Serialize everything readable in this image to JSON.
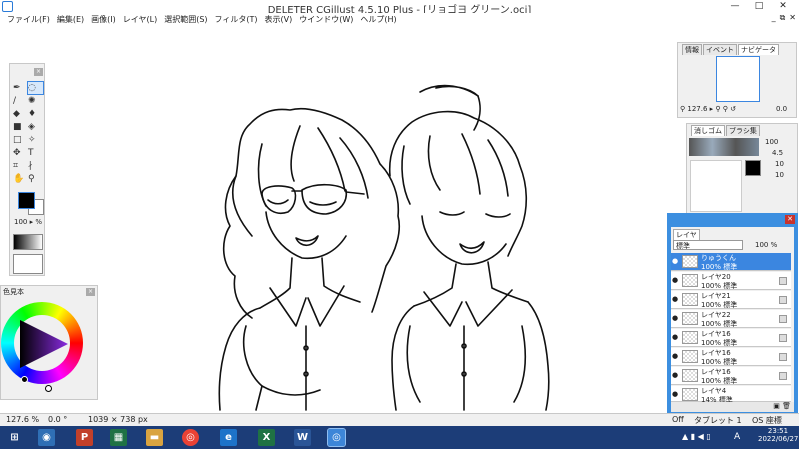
{
  "window": {
    "title": "DELETER CGillust 4.5.10 Plus - [リョゴヨ グリーン.oci]",
    "minimize_glyph": "—",
    "maximize_glyph": "□",
    "close_glyph": "✕"
  },
  "menu": [
    {
      "label": "ファイル(F)"
    },
    {
      "label": "編集(E)"
    },
    {
      "label": "画像(I)"
    },
    {
      "label": "レイヤ(L)"
    },
    {
      "label": "選択範囲(S)"
    },
    {
      "label": "フィルタ(T)"
    },
    {
      "label": "表示(V)"
    },
    {
      "label": "ウインドウ(W)"
    },
    {
      "label": "ヘルプ(H)"
    }
  ],
  "mdi_controls": {
    "minimize": "_",
    "restore": "⧉",
    "close": "✕"
  },
  "tool_palette": {
    "close_glyph": "×",
    "brush_size": "100",
    "brush_unit": "%",
    "tools": [
      {
        "name": "pen-tool-icon",
        "glyph": "✒"
      },
      {
        "name": "lasso-tool-icon",
        "glyph": "◌",
        "selected": true
      },
      {
        "name": "brush-tool-icon",
        "glyph": "∕"
      },
      {
        "name": "airbrush-tool-icon",
        "glyph": "✺"
      },
      {
        "name": "blur-tool-icon",
        "glyph": "◆"
      },
      {
        "name": "dropper-tool-icon",
        "glyph": "♦"
      },
      {
        "name": "fill-tool-icon",
        "glyph": "■"
      },
      {
        "name": "bucket-tool-icon",
        "glyph": "◈"
      },
      {
        "name": "select-rect-icon",
        "glyph": "□"
      },
      {
        "name": "magic-wand-icon",
        "glyph": "✧"
      },
      {
        "name": "move-tool-icon",
        "glyph": "✥"
      },
      {
        "name": "text-tool-icon",
        "glyph": "T"
      },
      {
        "name": "crop-tool-icon",
        "glyph": "⌗"
      },
      {
        "name": "eyedrop-icon",
        "glyph": "∤"
      },
      {
        "name": "hand-tool-icon",
        "glyph": "✋"
      },
      {
        "name": "zoom-tool-icon",
        "glyph": "⚲"
      }
    ]
  },
  "color_palette": {
    "title": "色見本",
    "close_glyph": "×"
  },
  "navigator": {
    "tabs": [
      "情報",
      "イベント",
      "ナビゲータ"
    ],
    "zoom": "127.6",
    "angle": "0.0"
  },
  "brush_panel": {
    "tabs": [
      "消しゴム",
      "ブラシ集"
    ],
    "size": "100",
    "value1": "4.5",
    "value2": "10",
    "value3": "10"
  },
  "layer_panel": {
    "tab": "レイヤ",
    "blend_mode": "標準",
    "opacity": "100",
    "opacity_unit": "%",
    "layers": [
      {
        "name": "りゅうくん",
        "sub": "100% 標準",
        "selected": true
      },
      {
        "name": "レイヤ20",
        "sub": "100% 標準"
      },
      {
        "name": "レイヤ21",
        "sub": "100% 標準"
      },
      {
        "name": "レイヤ22",
        "sub": "100% 標準"
      },
      {
        "name": "レイヤ16",
        "sub": "100% 標準"
      },
      {
        "name": "レイヤ16",
        "sub": "100% 標準"
      },
      {
        "name": "レイヤ16",
        "sub": "100% 標準"
      },
      {
        "name": "レイヤ4",
        "sub": "14% 標準"
      }
    ]
  },
  "statusbar": {
    "zoom": "127.6 %",
    "angle": "0.0 °",
    "size": "1039 × 738 px",
    "off": "Off",
    "tablet": "タブレット 1",
    "os": "OS 座標"
  },
  "taskbar": {
    "time": "23:51",
    "date": "2022/06/27",
    "ime": "A"
  },
  "colors": {
    "accent": "#3b86e0",
    "taskbar": "#1c3d78",
    "excel": "#1f7244",
    "powerpoint": "#c2402a",
    "word": "#2a5597"
  }
}
